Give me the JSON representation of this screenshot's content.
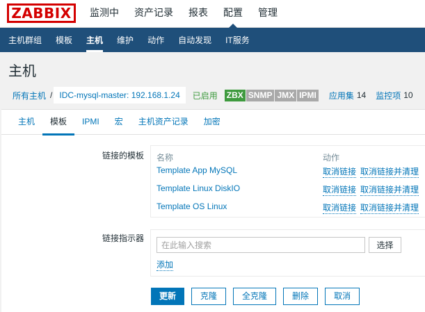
{
  "header": {
    "logo": "ZABBIX",
    "nav": [
      "监测中",
      "资产记录",
      "报表",
      "配置",
      "管理"
    ],
    "active": "配置"
  },
  "subnav": {
    "items": [
      "主机群组",
      "模板",
      "主机",
      "维护",
      "动作",
      "自动发现",
      "IT服务"
    ],
    "active": "主机"
  },
  "page": {
    "title": "主机"
  },
  "breadcrumb": {
    "all_hosts": "所有主机",
    "separator": "/",
    "host": "IDC-mysql-master: 192.168.1.24"
  },
  "status": {
    "enabled": "已启用",
    "tags": [
      {
        "label": "ZBX",
        "color": "#3e9a3e"
      },
      {
        "label": "SNMP",
        "color": "#a9a9a9"
      },
      {
        "label": "JMX",
        "color": "#a9a9a9"
      },
      {
        "label": "IPMI",
        "color": "#a9a9a9"
      }
    ],
    "applications_label": "应用集",
    "applications_count": "14",
    "items_label": "监控项",
    "items_count": "10"
  },
  "tabs": {
    "items": [
      "主机",
      "模板",
      "IPMI",
      "宏",
      "主机资产记录",
      "加密"
    ],
    "active": "模板"
  },
  "form": {
    "linked_templates_label": "链接的模板",
    "col_name": "名称",
    "col_action": "动作",
    "templates": [
      {
        "name": "Template App MySQL",
        "unlink": "取消链接",
        "unlink_clear": "取消链接并清理"
      },
      {
        "name": "Template Linux DiskIO",
        "unlink": "取消链接",
        "unlink_clear": "取消链接并清理"
      },
      {
        "name": "Template OS Linux",
        "unlink": "取消链接",
        "unlink_clear": "取消链接并清理"
      }
    ],
    "link_indicator_label": "链接指示器",
    "search_placeholder": "在此输入搜索",
    "search_value": "",
    "select_button": "选择",
    "add_link": "添加"
  },
  "buttons": {
    "update": "更新",
    "clone": "克隆",
    "full_clone": "全克隆",
    "delete": "删除",
    "cancel": "取消"
  },
  "colors": {
    "brand": "#d40000",
    "nav_bg": "#1f4f7a",
    "link": "#0275b8",
    "enabled": "#3e9a3e"
  }
}
